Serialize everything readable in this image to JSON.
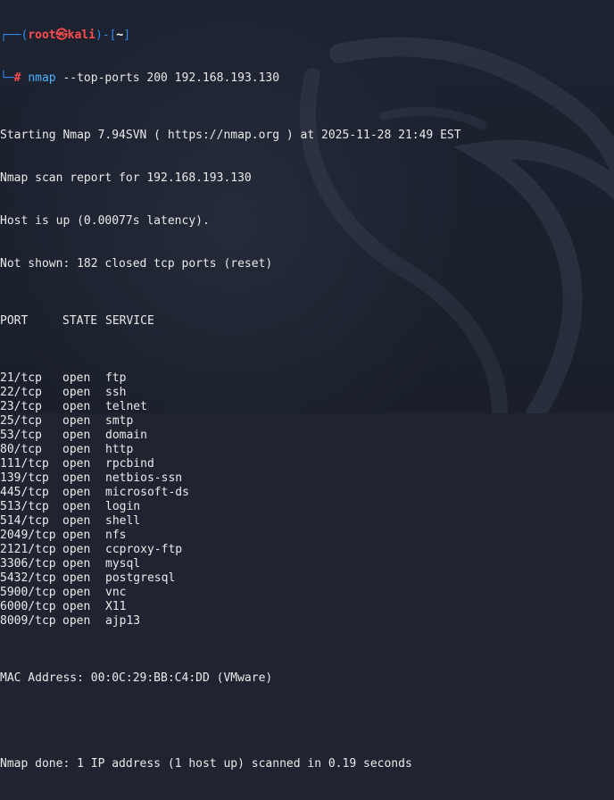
{
  "prompt": {
    "bracket_open": "┌──(",
    "user": "root㉿kali",
    "bracket_mid": ")-[",
    "path": "~",
    "bracket_close": "]",
    "corner": "└─",
    "hash": "#",
    "command": "nmap",
    "args": " --top-ports 200 192.168.193.130"
  },
  "output": {
    "starting": "Starting Nmap 7.94SVN ( https://nmap.org ) at 2025-11-28 21:49 EST",
    "report": "Nmap scan report for 192.168.193.130",
    "host_up": "Host is up (0.00077s latency).",
    "not_shown": "Not shown: 182 closed tcp ports (reset)",
    "header": {
      "port": "PORT",
      "state": "STATE",
      "service": "SERVICE"
    },
    "ports": [
      {
        "port": "21/tcp",
        "state": "open",
        "service": "ftp"
      },
      {
        "port": "22/tcp",
        "state": "open",
        "service": "ssh"
      },
      {
        "port": "23/tcp",
        "state": "open",
        "service": "telnet"
      },
      {
        "port": "25/tcp",
        "state": "open",
        "service": "smtp"
      },
      {
        "port": "53/tcp",
        "state": "open",
        "service": "domain"
      },
      {
        "port": "80/tcp",
        "state": "open",
        "service": "http"
      },
      {
        "port": "111/tcp",
        "state": "open",
        "service": "rpcbind"
      },
      {
        "port": "139/tcp",
        "state": "open",
        "service": "netbios-ssn"
      },
      {
        "port": "445/tcp",
        "state": "open",
        "service": "microsoft-ds"
      },
      {
        "port": "513/tcp",
        "state": "open",
        "service": "login"
      },
      {
        "port": "514/tcp",
        "state": "open",
        "service": "shell"
      },
      {
        "port": "2049/tcp",
        "state": "open",
        "service": "nfs"
      },
      {
        "port": "2121/tcp",
        "state": "open",
        "service": "ccproxy-ftp"
      },
      {
        "port": "3306/tcp",
        "state": "open",
        "service": "mysql"
      },
      {
        "port": "5432/tcp",
        "state": "open",
        "service": "postgresql"
      },
      {
        "port": "5900/tcp",
        "state": "open",
        "service": "vnc"
      },
      {
        "port": "6000/tcp",
        "state": "open",
        "service": "X11"
      },
      {
        "port": "8009/tcp",
        "state": "open",
        "service": "ajp13"
      }
    ],
    "mac": "MAC Address: 00:0C:29:BB:C4:DD (VMware)",
    "done": "Nmap done: 1 IP address (1 host up) scanned in 0.19 seconds"
  },
  "colors": {
    "background": "#1f2430",
    "prompt_frame": "#2f8cf2",
    "prompt_user": "#ff4d4d",
    "command": "#4fb0ff",
    "text": "#eaeaea"
  },
  "icons": {
    "background_watermark": "kali-dragon-icon"
  }
}
